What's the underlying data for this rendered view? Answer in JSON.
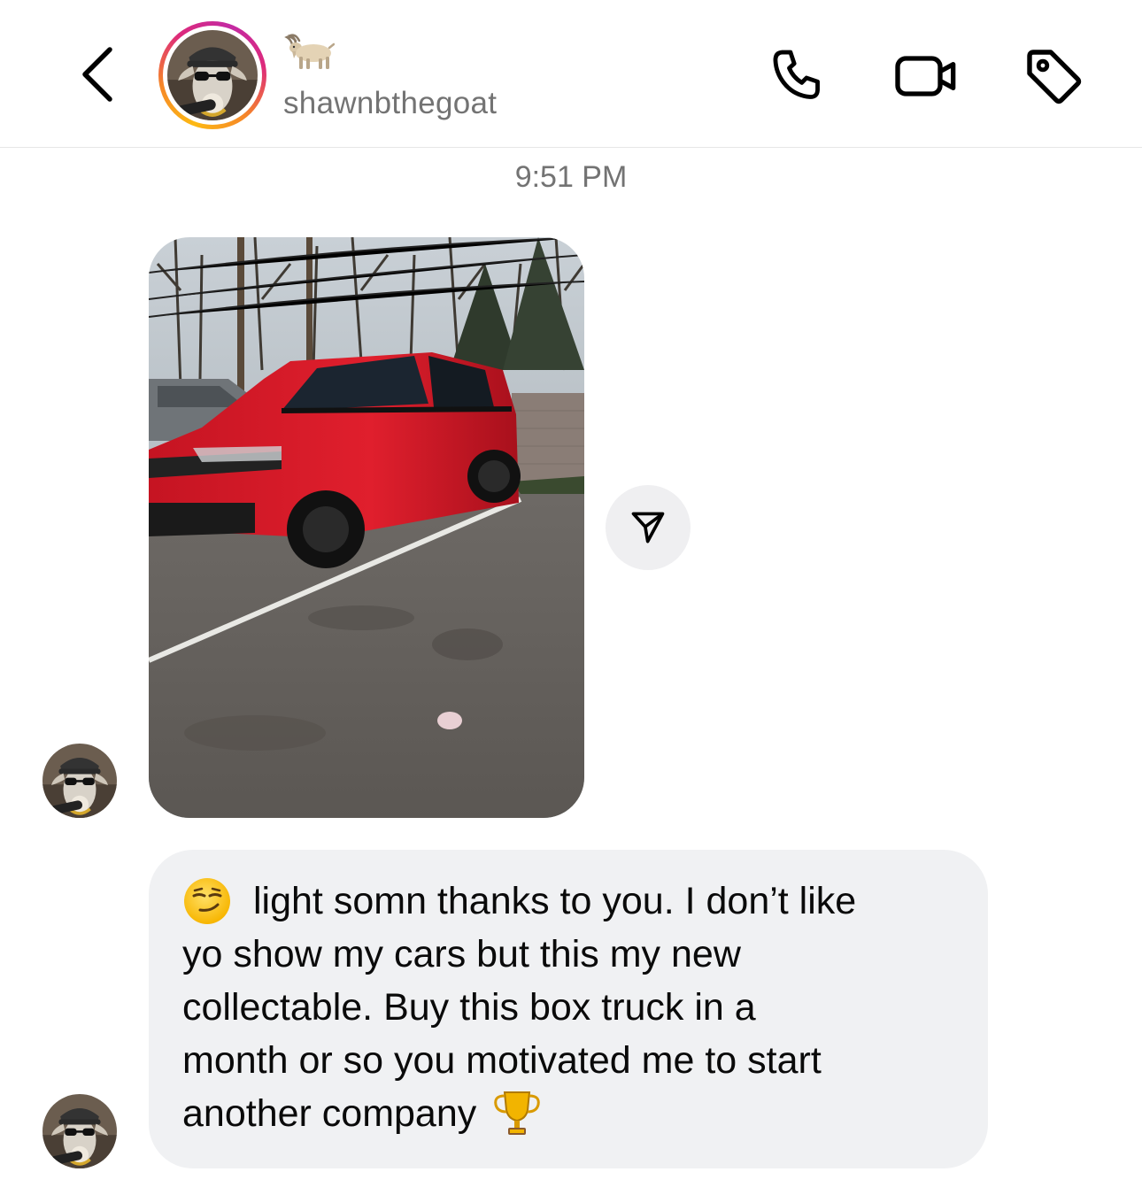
{
  "header": {
    "back_label": "Back",
    "display_name": "🐐",
    "username": "shawnbthegoat",
    "icons": [
      "chevron-left-icon",
      "phone-icon",
      "video-camera-icon",
      "tag-icon"
    ],
    "story_ring_colors": [
      "#fdb913",
      "#f58529",
      "#dd2a7b",
      "#c32aa3"
    ]
  },
  "thread": {
    "timestamp": "9:51 PM",
    "photo_message": {
      "description_icon": "red-suv-photo",
      "share_icon": "send-icon"
    },
    "text_message": {
      "leading_emoji": "smirking-face-emoji",
      "trailing_emoji": "trophy-emoji",
      "lines": [
        "light somn thanks to you. I don’t like",
        "yo show my cars but this my new",
        "collectable. Buy this box truck in a",
        "month or so you motivated me to start",
        "another company"
      ]
    }
  },
  "colors": {
    "bubble_bg": "#f0f1f3",
    "muted_text": "#737373",
    "share_bg": "#efeff1"
  }
}
